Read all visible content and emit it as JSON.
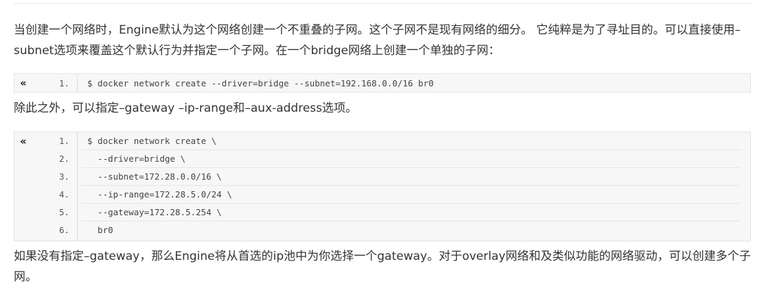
{
  "paragraphs": {
    "p1": "当创建一个网络时，Engine默认为这个网络创建一个不重叠的子网。这个子网不是现有网络的细分。 它纯粹是为了寻址目的。可以直接使用–subnet选项来覆盖这个默认行为并指定一个子网。在一个bridge网络上创建一个单独的子网：",
    "p2": "除此之外，可以指定–gateway –ip-range和–aux-address选项。",
    "p3": "如果没有指定–gateway，那么Engine将从首选的ip池中为你选择一个gateway。对于overlay网络和及类似功能的网络驱动，可以创建多个子网。"
  },
  "code_blocks": [
    {
      "toggle_symbol": "«",
      "lines": [
        {
          "num": "1.",
          "text": "$ docker network create --driver=bridge --subnet=192.168.0.0/16 br0"
        }
      ]
    },
    {
      "toggle_symbol": "«",
      "lines": [
        {
          "num": "1.",
          "text": "$ docker network create \\"
        },
        {
          "num": "2.",
          "text": "  --driver=bridge \\"
        },
        {
          "num": "3.",
          "text": "  --subnet=172.28.0.0/16 \\"
        },
        {
          "num": "4.",
          "text": "  --ip-range=172.28.5.0/24 \\"
        },
        {
          "num": "5.",
          "text": "  --gateway=172.28.5.254 \\"
        },
        {
          "num": "6.",
          "text": "  br0"
        }
      ]
    }
  ]
}
